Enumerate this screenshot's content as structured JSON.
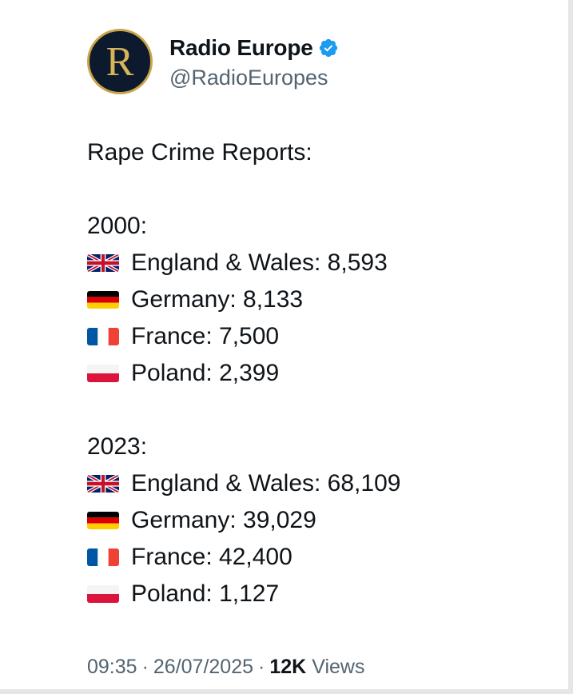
{
  "author": {
    "avatar_letter": "R",
    "display_name": "Radio Europe",
    "handle": "@RadioEuropes",
    "verified": true,
    "verified_color": "#1d9bf0",
    "avatar_bg": "#0d1a2d",
    "avatar_ring": "#c9a54a"
  },
  "tweet": {
    "heading": "Rape Crime Reports:",
    "sections": [
      {
        "year_label": "2000:",
        "rows": [
          {
            "flag": "uk-flag-icon",
            "text": "England & Wales: 8,593"
          },
          {
            "flag": "germany-flag-icon",
            "text": "Germany: 8,133"
          },
          {
            "flag": "france-flag-icon",
            "text": "France: 7,500"
          },
          {
            "flag": "poland-flag-icon",
            "text": "Poland: 2,399"
          }
        ]
      },
      {
        "year_label": "2023:",
        "rows": [
          {
            "flag": "uk-flag-icon",
            "text": "England & Wales: 68,109"
          },
          {
            "flag": "germany-flag-icon",
            "text": "Germany: 39,029"
          },
          {
            "flag": "france-flag-icon",
            "text": "France: 42,400"
          },
          {
            "flag": "poland-flag-icon",
            "text": "Poland: 1,127"
          }
        ]
      }
    ]
  },
  "footer": {
    "time": "09:35",
    "separator": "·",
    "date": "26/07/2025",
    "views_count": "12K",
    "views_label": "Views"
  }
}
